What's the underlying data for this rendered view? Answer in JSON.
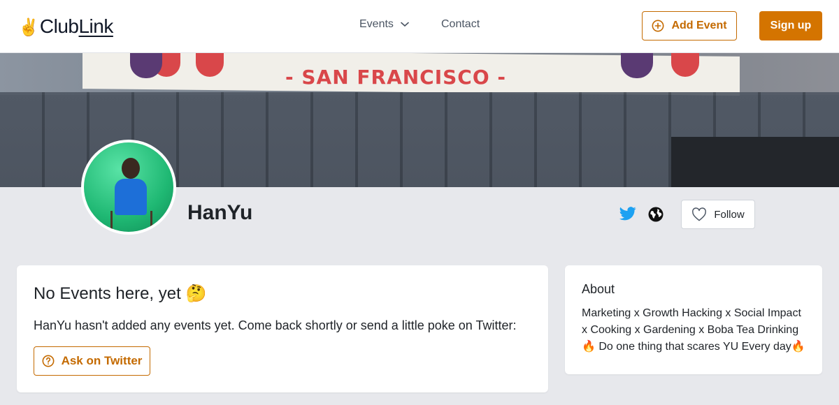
{
  "header": {
    "logo_hand": "✌️",
    "logo_club": "Club",
    "logo_link": "Link",
    "nav_events": "Events",
    "nav_contact": "Contact",
    "add_event": "Add Event",
    "sign_up": "Sign up"
  },
  "banner": {
    "sign_text": "- SAN FRANCISCO -"
  },
  "profile": {
    "name": "HanYu",
    "follow": "Follow"
  },
  "events_card": {
    "title": "No Events here, yet 🤔",
    "message": "HanYu hasn't added any events yet. Come back shortly or send a little poke on Twitter:",
    "ask_button": "Ask on Twitter"
  },
  "about_card": {
    "title": "About",
    "text": "Marketing x Growth Hacking x Social Impact x Cooking x Gardening x Boba Tea Drinking 🔥 Do one thing that scares YU Every day🔥"
  },
  "colors": {
    "accent": "#d47400",
    "accent_outline": "#c46a00",
    "twitter": "#1da1f2",
    "background": "#e7e8ec"
  }
}
